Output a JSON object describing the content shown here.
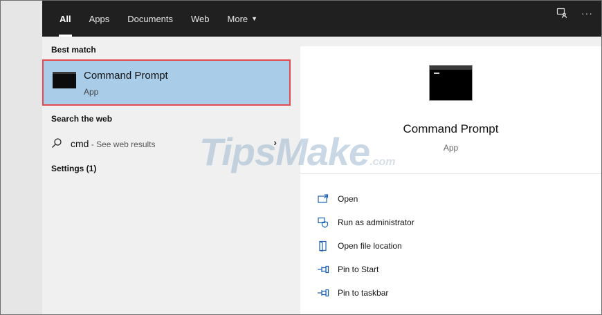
{
  "tabs": [
    {
      "label": "All",
      "active": true
    },
    {
      "label": "Apps",
      "active": false
    },
    {
      "label": "Documents",
      "active": false
    },
    {
      "label": "Web",
      "active": false
    },
    {
      "label": "More",
      "active": false
    }
  ],
  "topbar_icons": {
    "feedback": "feedback-person-icon",
    "more": "more-dots-icon",
    "more_text": "···"
  },
  "results": {
    "best_match_label": "Best match",
    "best_item": {
      "title": "Command Prompt",
      "subtitle": "App",
      "icon": "command-prompt-icon"
    },
    "search_web_label": "Search the web",
    "web_result": {
      "query": "cmd",
      "hint": " - See web results",
      "icon": "search-icon"
    },
    "settings_label": "Settings (1)"
  },
  "detail": {
    "title": "Command Prompt",
    "subtitle": "App",
    "actions": [
      {
        "label": "Open",
        "icon": "open-icon"
      },
      {
        "label": "Run as administrator",
        "icon": "run-as-admin-icon"
      },
      {
        "label": "Open file location",
        "icon": "file-location-icon"
      },
      {
        "label": "Pin to Start",
        "icon": "pin-icon"
      },
      {
        "label": "Pin to taskbar",
        "icon": "pin-icon"
      }
    ]
  },
  "watermark": {
    "main": "TipsMake",
    "suffix": ".com"
  },
  "colors": {
    "topbar": "#202020",
    "selection": "#a9cce8",
    "highlight_border": "#e5484d",
    "accent_icon": "#1a5fb4"
  }
}
